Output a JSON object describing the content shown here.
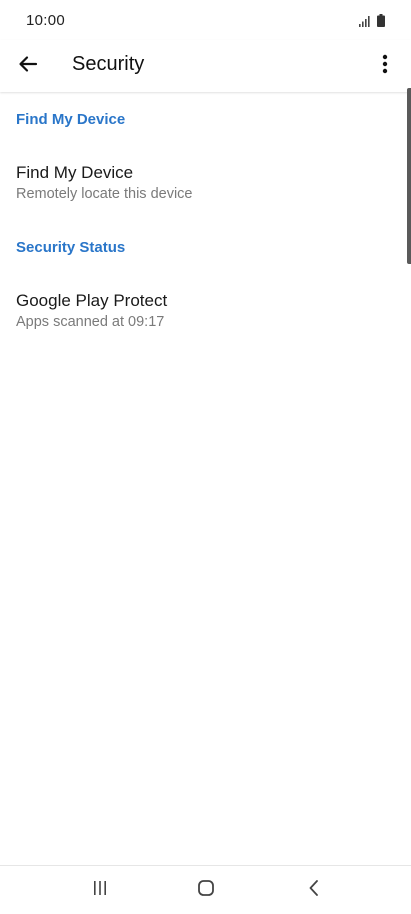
{
  "status_bar": {
    "time": "10:00",
    "signal_icon": "signal-icon",
    "battery_icon": "battery-icon"
  },
  "app_bar": {
    "title": "Security",
    "back_icon": "arrow-back-icon",
    "more_icon": "more-vertical-icon"
  },
  "sections": [
    {
      "header": "Find My Device",
      "items": [
        {
          "title": "Find My Device",
          "subtitle": "Remotely locate this device"
        }
      ]
    },
    {
      "header": "Security Status",
      "items": [
        {
          "title": "Google Play Protect",
          "subtitle": "Apps scanned at 09:17"
        }
      ]
    }
  ],
  "nav_bar": {
    "recents_icon": "recents-icon",
    "home_icon": "home-icon",
    "back_icon": "nav-back-icon"
  },
  "colors": {
    "accent": "#2a76c9",
    "text_primary": "#1a1a1a",
    "text_secondary": "#7a7a7a"
  }
}
